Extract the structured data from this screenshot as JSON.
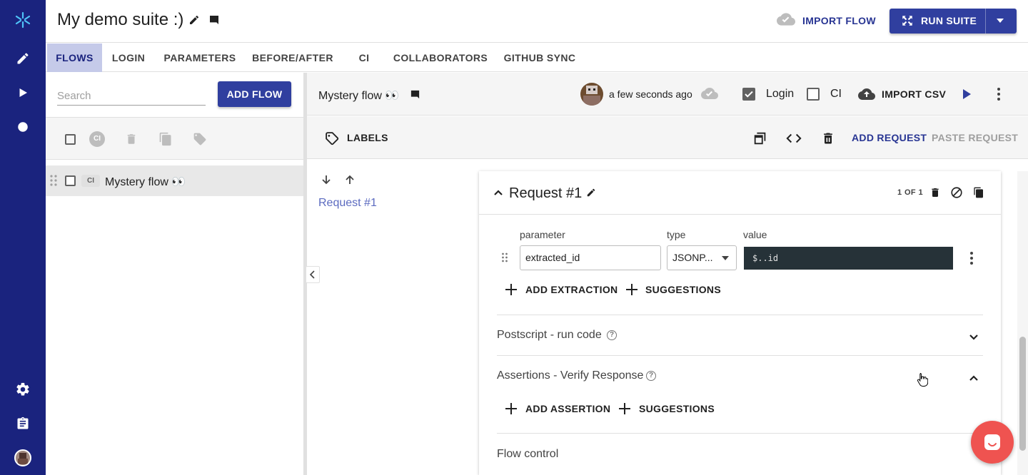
{
  "app": {
    "suite_title": "My demo suite :)",
    "import_flow_label": "IMPORT FLOW",
    "run_suite_label": "RUN SUITE",
    "accent_color": "#303f9f",
    "nav_color": "#1a237e"
  },
  "tabs": [
    {
      "label": "FLOWS",
      "active": true
    },
    {
      "label": "LOGIN"
    },
    {
      "label": "PARAMETERS"
    },
    {
      "label": "BEFORE/AFTER"
    },
    {
      "label": "CI"
    },
    {
      "label": "COLLABORATORS"
    },
    {
      "label": "GITHUB SYNC"
    }
  ],
  "left_panel": {
    "search_placeholder": "Search",
    "add_flow_label": "ADD FLOW",
    "ci_badge": "CI",
    "flows": [
      {
        "ci_tag": "CI",
        "name": "Mystery flow 👀"
      }
    ]
  },
  "flow_header": {
    "name": "Mystery flow 👀",
    "last_saved": "a few seconds ago",
    "login_label": "Login",
    "login_checked": true,
    "ci_label": "CI",
    "ci_checked": false,
    "import_csv_label": "IMPORT CSV"
  },
  "labels_row": {
    "labels_label": "LABELS",
    "add_request_label": "ADD REQUEST",
    "paste_request_label": "PASTE REQUEST"
  },
  "request_nav": {
    "items": [
      "Request #1"
    ]
  },
  "request_card": {
    "title": "Request #1",
    "pagination": "1 OF 1",
    "extraction": {
      "parameter_label": "parameter",
      "type_label": "type",
      "value_label": "value",
      "parameter_value": "extracted_id",
      "type_value": "JSONP...",
      "value_value": "$..id"
    },
    "add_extraction_label": "ADD EXTRACTION",
    "suggestions_label": "SUGGESTIONS",
    "postscript_title": "Postscript - run code",
    "assertions_title": "Assertions - Verify Response",
    "add_assertion_label": "ADD ASSERTION",
    "suggestions_label_2": "SUGGESTIONS",
    "flow_control_title": "Flow control"
  }
}
